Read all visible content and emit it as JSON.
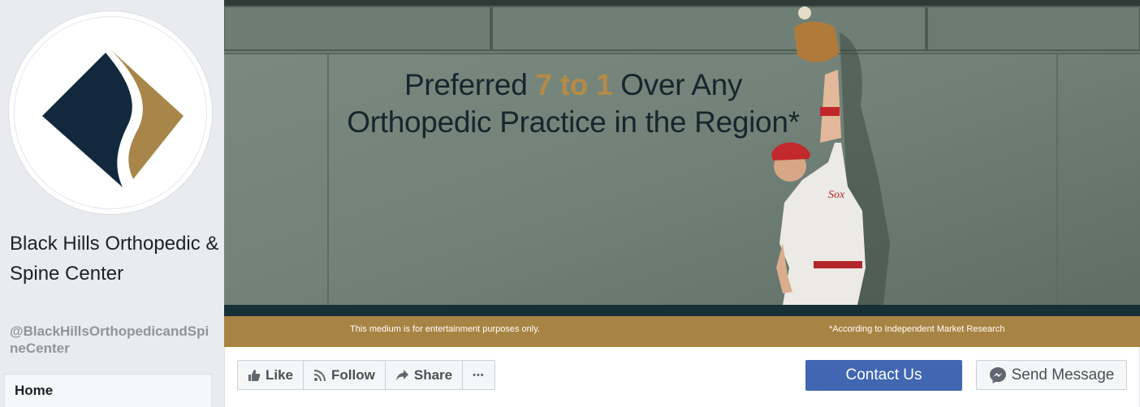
{
  "profile": {
    "name": "Black Hills Orthopedic & Spine Center",
    "handle": "@BlackHillsOrthopedicandSpineCenter",
    "logo_colors": {
      "navy": "#11283d",
      "gold": "#a8864a"
    }
  },
  "nav": {
    "home_label": "Home"
  },
  "cover": {
    "headline_pre": "Preferred ",
    "headline_accent": "7 to 1",
    "headline_post": " Over Any",
    "headline_line2": "Orthopedic Practice in the Region*",
    "disclaimer_left": "This medium is for entertainment purposes only.",
    "disclaimer_right": "*According to Independent Market Research",
    "accent_color": "#b58b46",
    "band_color": "#a88444"
  },
  "actions": {
    "like_label": "Like",
    "follow_label": "Follow",
    "share_label": "Share",
    "more_label": "•••",
    "contact_label": "Contact Us",
    "send_label": "Send Message"
  }
}
